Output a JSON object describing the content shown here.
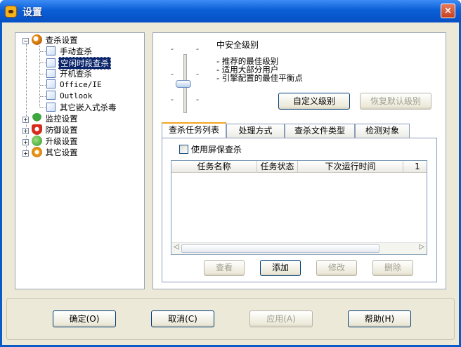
{
  "window": {
    "title": "设置",
    "close": "×"
  },
  "tree": {
    "items": [
      {
        "label": "查杀设置",
        "type": "group",
        "expander": "−"
      },
      {
        "label": "手动查杀",
        "type": "leaf"
      },
      {
        "label": "空闲时段查杀",
        "type": "leaf",
        "selected": true
      },
      {
        "label": "开机查杀",
        "type": "leaf"
      },
      {
        "label": "Office/IE",
        "type": "leaf"
      },
      {
        "label": "Outlook",
        "type": "leaf"
      },
      {
        "label": "其它嵌入式杀毒",
        "type": "leaf"
      },
      {
        "label": "监控设置",
        "type": "group",
        "expander": "+"
      },
      {
        "label": "防御设置",
        "type": "group",
        "expander": "+"
      },
      {
        "label": "升级设置",
        "type": "group",
        "expander": "+"
      },
      {
        "label": "其它设置",
        "type": "group",
        "expander": "+"
      }
    ]
  },
  "security": {
    "level_title": "中安全级别",
    "desc": [
      "- 推荐的最佳级别",
      "- 适用大部分用户",
      "- 引擎配置的最佳平衡点"
    ],
    "level_fraction": 0.5,
    "ticks": [
      "-",
      "-",
      "-",
      "-",
      "-",
      "-",
      "-",
      "-"
    ],
    "custom_button": "自定义级别",
    "restore_button": "恢复默认级别"
  },
  "tabs": [
    "查杀任务列表",
    "处理方式",
    "查杀文件类型",
    "检测对象"
  ],
  "task": {
    "checkbox_label": "使用屏保查杀",
    "columns": [
      "任务名称",
      "任务状态",
      "下次运行时间",
      "1"
    ],
    "scroll_left": "◁",
    "scroll_right": "▷",
    "buttons": {
      "view": "查看",
      "add": "添加",
      "modify": "修改",
      "delete": "删除"
    }
  },
  "footer": {
    "ok": "确定(O)",
    "cancel": "取消(C)",
    "apply": "应用(A)",
    "help": "帮助(H)"
  },
  "colors": {
    "titlebar": "#0b5fd6",
    "selection": "#0a246a",
    "tab_accent": "#f5a623"
  }
}
